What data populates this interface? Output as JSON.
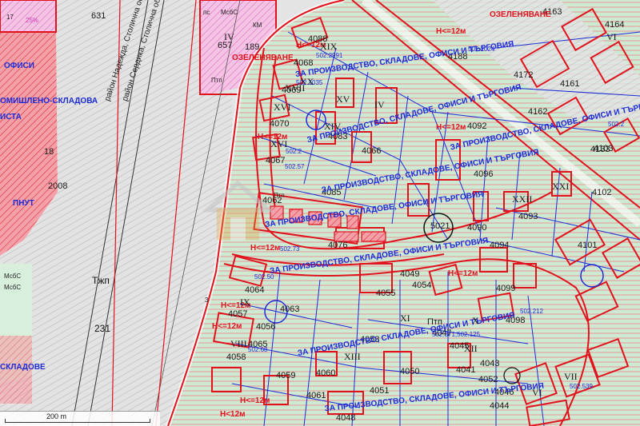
{
  "labels": {
    "lots": [
      "4088",
      "4068",
      "4069",
      "4070",
      "4083",
      "4066",
      "4067",
      "4062",
      "4076",
      "4092",
      "4096",
      "4099",
      "4098",
      "4064",
      "4063",
      "4065",
      "4058",
      "4059",
      "4061",
      "4060",
      "4048",
      "4056",
      "4057",
      "4055",
      "4054",
      "4053",
      "4049",
      "4052",
      "4050",
      "4051",
      "4085",
      "4093",
      "4094",
      "4090",
      "4103",
      "4102",
      "4101",
      "4133",
      "4162",
      "4161",
      "4172",
      "4188",
      "4163",
      "4164",
      "4044",
      "4045",
      "4046",
      "4047",
      "4041",
      "4043",
      "5021",
      "2008",
      "631",
      "657",
      "189",
      "231",
      "18"
    ],
    "zones_red": [
      "Н<=12м",
      "Н<=12м",
      "Н<=12м",
      "Н<=12м",
      "Н<=12м",
      "Н<=12м",
      "Н<=12м",
      "Н<12м",
      "Н<=12м",
      "Н<=12м"
    ],
    "zones_blue": [
      "ЗА ПРОИЗВОДСТВО, СКЛАДОВЕ, ОФИСИ И ТЪРГОВИЯ",
      "ЗА ПРОИЗВОДСТВО, СКЛАДОВЕ, ОФИСИ И ТЪРГОВИЯ",
      "ЗА ПРОИЗВОДСТВО, СКЛАДОВЕ, ОФИСИ И ТЪРГОВИЯ",
      "ЗА ПРОИЗВОДСТВО, СКЛАДОВЕ, ОФИСИ И ТЪРГОВИЯ",
      "ЗА ПРОИЗВОДСТВО, СКЛАДОВЕ, ОФИСИ И ТЪРГОВИЯ",
      "ЗА ПРОИЗВОДСТВО, СКЛАДОВЕ, ОФИСИ И ТЪРГОВИЯ",
      "ЗА ПРОИЗВОДСТВО, СКЛАДОВЕ, ОФИСИ И ТЪРГОВИЯ",
      "ЗА ПРОИЗВОДСТВО, СКЛАДОВЕ, ОФИСИ И ТЪРГОВИЯ"
    ],
    "romans": [
      "XIX",
      "XX",
      "XVII",
      "XVI",
      "XV",
      "XVI",
      "XIV",
      "IV",
      "VIII",
      "IX",
      "XI",
      "XII",
      "X",
      "XIII",
      "VII",
      "VI",
      "VI",
      "XXI",
      "XXII"
    ],
    "parcels": [
      "502.2024",
      "502.2991",
      "502.1035",
      "502.2",
      "502.57",
      "502.73",
      "502.68",
      "502.50",
      "502.371,502.125",
      "502.539",
      "502.2",
      "502.212"
    ],
    "green_zone_left": "ОЗЕЛЕНЯВАНЕ",
    "green_zone_right": "ОЗЕЛЕНЯВАНЕ",
    "left_red_office": "ОФИСИ",
    "left_red_industry": "ОМИШЛЕНО-СКЛАДОВА",
    "left_red_ista": "ИСТА",
    "left_pnut": "ПНУТ",
    "left_skladove": "СКЛАДОВЕ",
    "tzhp": "Тжп",
    "ptp_1": "Птп",
    "ptp_2": "Птп",
    "ptp_3": "Птп",
    "roman_iv": "IV",
    "pc": "пс",
    "mos": "МсбС",
    "mos_2": "МсбС",
    "mos_3": "МсбС",
    "km": "КМ",
    "road_1": "район Надежда, Столична община, област",
    "road_2": "район Сердика, Столична община, об",
    "pct": "25%",
    "num_17": "17",
    "num_3": "3"
  },
  "scale": {
    "label": "200 m"
  },
  "colors": {
    "gray_area": "#dcdcdc",
    "green_area": "#c9e8cf",
    "red_zone": "#f5a8b0",
    "red_line": "#e0121c",
    "blue_line": "#1c2bd6",
    "pink_area": "#f6c8e6",
    "magenta": "#d038b6"
  }
}
